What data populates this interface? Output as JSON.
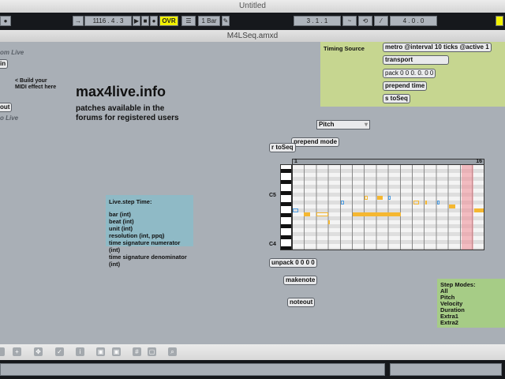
{
  "window": {
    "title": "Untitled",
    "document_title": "M4LSeq.amxd"
  },
  "transport": {
    "position": "1116 .  4 .  3",
    "ovr": "OVR",
    "quantize": "1 Bar",
    "loop_start": "3 .  1 .  1",
    "loop_length": "4 .  0 .  0"
  },
  "patch": {
    "from_live": "om Live",
    "midiin": "in",
    "build_hint_1": "< Build your",
    "build_hint_2": "MIDI effect here",
    "midiout": "out",
    "to_live": "o Live",
    "headline": "max4live.info",
    "sub1": "patches available in the",
    "sub2": "forums for registered users",
    "timing": {
      "title": "Timing Source",
      "metro": "metro @interval 10 ticks @active 1",
      "transport": "transport",
      "pack": "pack 0 0 0. 0. 0 0",
      "prepend": "prepend time",
      "send": "s toSeq"
    },
    "mode_menu": "Pitch",
    "prepend_mode": "prepend mode",
    "receive": "r toSeq",
    "step": {
      "start": "1",
      "end": "16",
      "label_c5": "C5",
      "label_c4": "C4"
    },
    "unpack": "unpack 0 0 0 0",
    "makenote": "makenote",
    "noteout": "noteout",
    "live_step": {
      "title": "Live.step Time:",
      "items": [
        "bar (int)",
        "beat (int)",
        "unit (int)",
        "resolution (int, ppq)",
        "time signature numerator (int)",
        "time signature denominator (int)"
      ]
    },
    "step_modes": {
      "title": "Step Modes:",
      "items": [
        "All",
        "Pitch",
        "Velocity",
        "Duration",
        "Extra1",
        "Extra2"
      ]
    }
  },
  "colors": {
    "accent": "#f2f200",
    "note": "#f5b731",
    "timing_bg": "#c6d690",
    "live_step_bg": "#8fbac6",
    "step_modes_bg": "#a6cc86"
  }
}
